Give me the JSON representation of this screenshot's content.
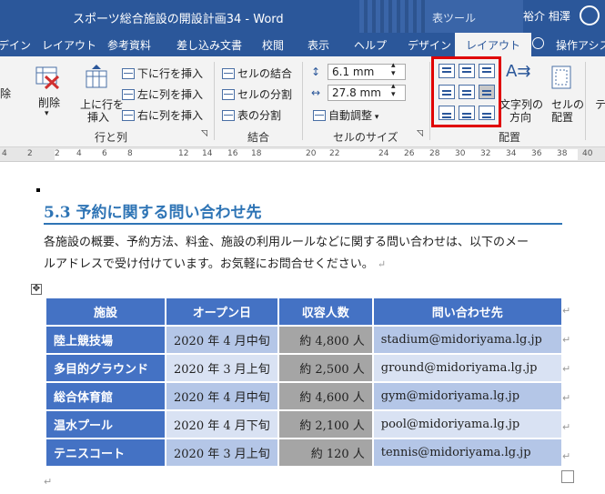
{
  "titlebar": {
    "doc_title": "スポーツ総合施設の開設計画34  -  Word",
    "context_label": "表ツール",
    "user": "裕介 相澤"
  },
  "tabs": [
    "デイン",
    "レイアウト",
    "参考資料",
    "差し込み文書",
    "校閲",
    "表示",
    "ヘルプ",
    "デザイン",
    "レイアウト",
    "操作アシス"
  ],
  "ribbon": {
    "delete_frag": "除",
    "delete": "削除",
    "insert_above": "上に行を",
    "insert_above2": "挿入",
    "insert_below": "下に行を挿入",
    "insert_left": "左に列を挿入",
    "insert_right": "右に列を挿入",
    "group_rows": "行と列",
    "merge_cells": "セルの結合",
    "split_cells": "セルの分割",
    "split_table": "表の分割",
    "group_merge": "結合",
    "height": "6.1 mm",
    "width": "27.8 mm",
    "autofit": "自動調整",
    "group_size": "セルのサイズ",
    "text_direction": "文字列の",
    "text_direction2": "方向",
    "cell_margins": "セルの",
    "cell_margins2": "配置",
    "group_align": "配置",
    "right_frag": "テ"
  },
  "ruler": [
    "4",
    "2",
    "2",
    "4",
    "6",
    "8",
    "12",
    "14",
    "16",
    "18",
    "20",
    "22",
    "24",
    "26",
    "28",
    "30",
    "32",
    "34",
    "36",
    "38",
    "40"
  ],
  "document": {
    "heading": "5.3   予約に関する問い合わせ先",
    "para_line1": "各施設の概要、予約方法、料金、施設の利用ルールなどに関する問い合わせは、以下のメー",
    "para_line2": "ルアドレスで受け付けています。お気軽にお問合せください。",
    "para_mark": "↵"
  },
  "table": {
    "headers": [
      "施設",
      "オープン日",
      "収容人数",
      "問い合わせ先"
    ],
    "rows": [
      [
        "陸上競技場",
        "2020 年 4 月中旬",
        "約 4,800 人",
        "stadium@midoriyama.lg.jp"
      ],
      [
        "多目的グラウンド",
        "2020 年 3 月上旬",
        "約 2,500 人",
        "ground@midoriyama.lg.jp"
      ],
      [
        "総合体育館",
        "2020 年 4 月中旬",
        "約 4,600 人",
        "gym@midoriyama.lg.jp"
      ],
      [
        "温水プール",
        "2020 年 4 月下旬",
        "約 2,100 人",
        "pool@midoriyama.lg.jp"
      ],
      [
        "テニスコート",
        "2020 年 3 月上旬",
        "約 120 人",
        "tennis@midoriyama.lg.jp"
      ]
    ]
  },
  "colors": {
    "word_blue": "#2b579a",
    "header_fill": "#4472c4",
    "heading_color": "#2e74b5",
    "highlight": "#e00000"
  }
}
